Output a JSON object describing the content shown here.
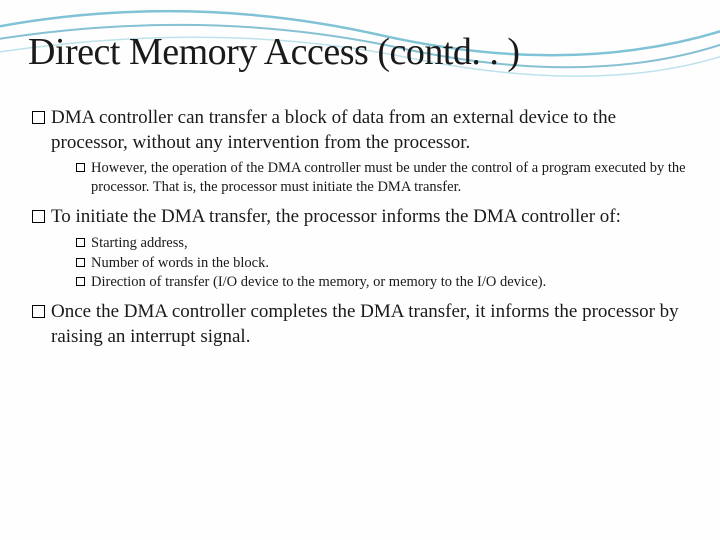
{
  "title": "Direct Memory Access (contd. . )",
  "points": [
    {
      "text": "DMA controller can transfer a block of data from an external device to the processor, without any intervention from the processor.",
      "subs": [
        "However, the operation of the DMA controller must be under the control of a program executed by the processor. That is, the processor must initiate the DMA transfer."
      ]
    },
    {
      "text": "To initiate the DMA transfer, the processor informs the DMA controller of:",
      "subs": [
        "Starting address,",
        "Number of words in the block.",
        "Direction of transfer (I/O device to the memory, or memory to the I/O device)."
      ]
    },
    {
      "text": "Once the DMA controller completes the DMA transfer, it informs the processor by raising an interrupt signal.",
      "subs": []
    }
  ]
}
